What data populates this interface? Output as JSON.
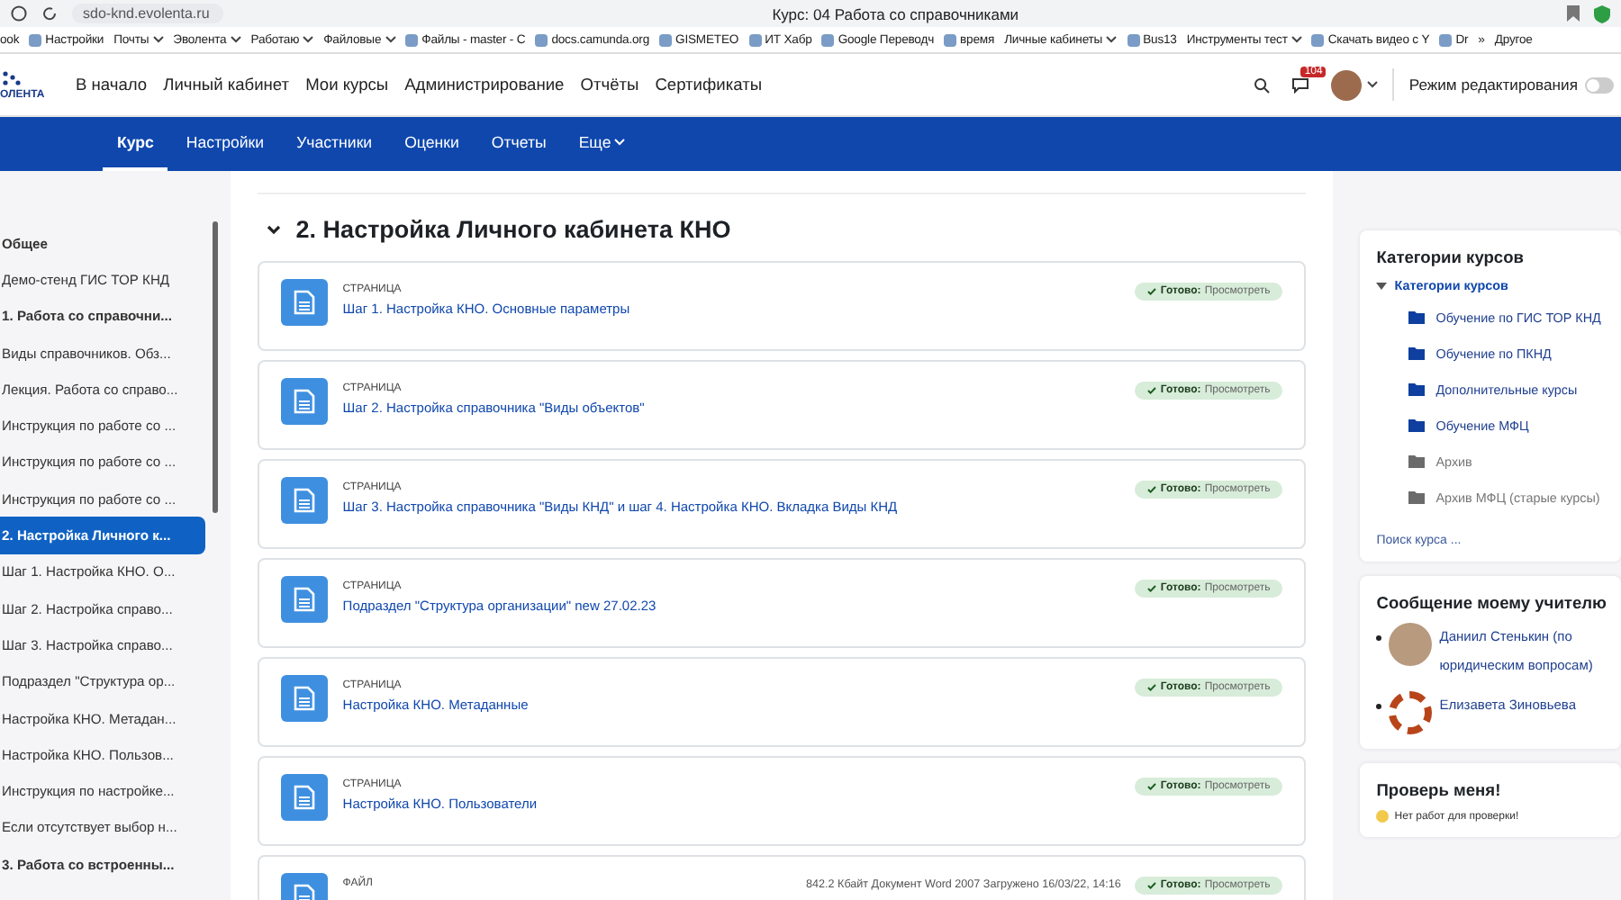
{
  "browser": {
    "url": "sdo-knd.evolenta.ru",
    "title": "Курс: 04 Работа со справочниками"
  },
  "bookmarks": [
    {
      "label": "ook",
      "kind": "plain"
    },
    {
      "label": "Настройки",
      "kind": "link"
    },
    {
      "label": "Почты",
      "kind": "folder"
    },
    {
      "label": "Эволента",
      "kind": "folder"
    },
    {
      "label": "Работаю",
      "kind": "folder"
    },
    {
      "label": "Файловые",
      "kind": "folder"
    },
    {
      "label": "Файлы - master - C",
      "kind": "link"
    },
    {
      "label": "docs.camunda.org",
      "kind": "link"
    },
    {
      "label": "GISMETEO",
      "kind": "link"
    },
    {
      "label": "ИТ Хабр",
      "kind": "link"
    },
    {
      "label": "Google Переводч",
      "kind": "link"
    },
    {
      "label": "время",
      "kind": "link"
    },
    {
      "label": "Личные кабинеты",
      "kind": "folder"
    },
    {
      "label": "Bus13",
      "kind": "link"
    },
    {
      "label": "Инструменты тест",
      "kind": "folder"
    },
    {
      "label": "Скачать видео с Y",
      "kind": "link"
    },
    {
      "label": "Dr",
      "kind": "link"
    },
    {
      "label": "»",
      "kind": "plain"
    },
    {
      "label": "Другое",
      "kind": "plain"
    }
  ],
  "header": {
    "logo": "ОЛЕНТА",
    "nav": [
      "В начало",
      "Личный кабинет",
      "Мои курсы",
      "Администрирование",
      "Отчёты",
      "Сертификаты"
    ],
    "notifications": "104",
    "edit_mode": {
      "label": "Режим редактирования",
      "on": false
    }
  },
  "course_tabs": [
    {
      "label": "Курс",
      "selected": true
    },
    {
      "label": "Настройки",
      "selected": false
    },
    {
      "label": "Участники",
      "selected": false
    },
    {
      "label": "Оценки",
      "selected": false
    },
    {
      "label": "Отчеты",
      "selected": false
    },
    {
      "label": "Еще",
      "selected": false,
      "menu": true
    }
  ],
  "sidebar": {
    "items": [
      {
        "label": "Общее",
        "section": true,
        "selected": false
      },
      {
        "label": "Демо-стенд ГИС ТОР КНД",
        "section": false,
        "selected": false
      },
      {
        "label": "1. Работа со справочни...",
        "section": true,
        "selected": false
      },
      {
        "label": "Виды справочников. Обз...",
        "section": false,
        "selected": false
      },
      {
        "label": "Лекция. Работа со справо...",
        "section": false,
        "selected": false
      },
      {
        "label": "Инструкция по работе со ...",
        "section": false,
        "selected": false
      },
      {
        "label": "Инструкция по работе со ...",
        "section": false,
        "selected": false
      },
      {
        "label": "Инструкция по работе со ...",
        "section": false,
        "selected": false
      },
      {
        "label": "2. Настройка Личного к...",
        "section": true,
        "selected": true
      },
      {
        "label": "Шаг 1. Настройка КНО. О...",
        "section": false,
        "selected": false
      },
      {
        "label": "Шаг 2. Настройка справо...",
        "section": false,
        "selected": false
      },
      {
        "label": "Шаг 3. Настройка справо...",
        "section": false,
        "selected": false
      },
      {
        "label": "Подраздел \"Структура ор...",
        "section": false,
        "selected": false
      },
      {
        "label": "Настройка КНО. Метадан...",
        "section": false,
        "selected": false
      },
      {
        "label": "Настройка КНО. Пользов...",
        "section": false,
        "selected": false
      },
      {
        "label": "Инструкция по настройке...",
        "section": false,
        "selected": false
      },
      {
        "label": "Если отсутствует выбор н...",
        "section": false,
        "selected": false
      },
      {
        "label": "3. Работа со встроенны...",
        "section": true,
        "selected": false
      }
    ]
  },
  "section": {
    "title": "2. Настройка Личного кабинета КНО",
    "expanded": true,
    "activities": [
      {
        "kind": "page",
        "type": "СТРАНИЦА",
        "title": "Шаг 1. Настройка КНО. Основные параметры",
        "status": "Готово:",
        "action": "Просмотреть"
      },
      {
        "kind": "page",
        "type": "СТРАНИЦА",
        "title": "Шаг 2. Настройка справочника \"Виды объектов\"",
        "status": "Готово:",
        "action": "Просмотреть"
      },
      {
        "kind": "page",
        "type": "СТРАНИЦА",
        "title": "Шаг 3. Настройка справочника \"Виды КНД\" и шаг 4. Настройка КНО. Вкладка Виды КНД",
        "status": "Готово:",
        "action": "Просмотреть"
      },
      {
        "kind": "page",
        "type": "СТРАНИЦА",
        "title": "Подраздел \"Структура организации\" new 27.02.23",
        "status": "Готово:",
        "action": "Просмотреть"
      },
      {
        "kind": "page",
        "type": "СТРАНИЦА",
        "title": "Настройка КНО. Метаданные",
        "status": "Готово:",
        "action": "Просмотреть"
      },
      {
        "kind": "page",
        "type": "СТРАНИЦА",
        "title": "Настройка КНО. Пользователи",
        "status": "Готово:",
        "action": "Просмотреть"
      },
      {
        "kind": "file",
        "type": "ФАЙЛ",
        "meta": "842.2 Кбайт Документ Word 2007 Загружено 16/03/22, 14:16",
        "status": "Готово:",
        "action": "Просмотреть"
      }
    ]
  },
  "blocks": {
    "categories": {
      "title": "Категории курсов",
      "root": {
        "label": "Категории курсов",
        "expanded": true,
        "children": [
          {
            "label": "Обучение по ГИС ТОР КНД",
            "hidden": false
          },
          {
            "label": "Обучение по ПКНД",
            "hidden": false
          },
          {
            "label": "Дополнительные курсы",
            "hidden": false
          },
          {
            "label": "Обучение МФЦ",
            "hidden": false
          },
          {
            "label": "Архив",
            "hidden": true
          },
          {
            "label": "Архив МФЦ (старые курсы)",
            "hidden": true
          }
        ]
      },
      "search": "Поиск курса ..."
    },
    "message": {
      "title": "Сообщение моему учителю",
      "teachers": [
        {
          "name": "Даниил Стенькин (по юридическим вопросам)",
          "kind": "photo"
        },
        {
          "name": "Елизавета Зиновьева",
          "kind": "default"
        }
      ]
    },
    "grading": {
      "title": "Проверь меня!",
      "note": "Нет работ для проверки!"
    }
  }
}
